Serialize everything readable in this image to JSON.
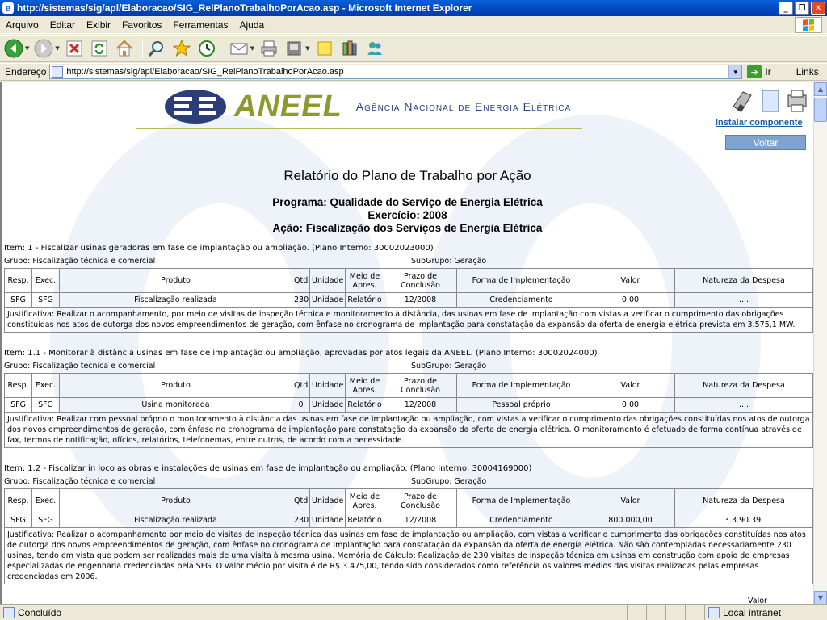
{
  "window": {
    "title": "http://sistemas/sig/apl/Elaboracao/SIG_RelPlanoTrabalhoPorAcao.asp - Microsoft Internet Explorer",
    "minimize": "_",
    "maximize": "❐",
    "close": "✕"
  },
  "menu": [
    "Arquivo",
    "Editar",
    "Exibir",
    "Favoritos",
    "Ferramentas",
    "Ajuda"
  ],
  "address": {
    "label": "Endereço",
    "url": "http://sistemas/sig/apl/Elaboracao/SIG_RelPlanoTrabalhoPorAcao.asp",
    "go": "Ir",
    "links": "Links"
  },
  "header": {
    "logo_text": "ANEEL",
    "logo_sub": "Agência Nacional de Energia Elétrica",
    "install": "Instalar componente",
    "back": "Voltar"
  },
  "report": {
    "title": "Relatório do Plano de Trabalho por Ação",
    "programa": "Programa: Qualidade do Serviço de Energia Elétrica",
    "exercicio": "Exercício: 2008",
    "acao": "Ação: Fiscalização dos Serviços de Energia Elétrica"
  },
  "columns": [
    "Resp.",
    "Exec.",
    "Produto",
    "Qtd",
    "Unidade",
    "Meio de Apres.",
    "Prazo de Conclusão",
    "Forma de Implementação",
    "Valor",
    "Natureza da Despesa"
  ],
  "items": [
    {
      "head": "Item: 1 - Fiscalizar usinas geradoras em fase de implantação ou ampliação. (Plano Interno: 30002023000)",
      "grupo": "Grupo: Fiscalização técnica e comercial",
      "subgrupo": "SubGrupo: Geração",
      "row": [
        "SFG",
        "SFG",
        "Fiscalização realizada",
        "230",
        "Unidade",
        "Relatório",
        "12/2008",
        "Credenciamento",
        "0,00",
        "...."
      ],
      "justificativa": "Justificativa: Realizar o acompanhamento, por meio de visitas de inspeção técnica e monitoramento à distância, das usinas em fase de implantação com vistas a verificar o cumprimento das obrigações constituídas nos atos de outorga dos novos empreendimentos de geração, com ênfase no cronograma de implantação para constatação da expansão da oferta de energia elétrica prevista em 3.575,1 MW."
    },
    {
      "head": "Item: 1.1 - Monitorar à distância usinas em fase de implantação ou ampliação, aprovadas por atos legais da ANEEL. (Plano Interno: 30002024000)",
      "grupo": "Grupo: Fiscalização técnica e comercial",
      "subgrupo": "SubGrupo: Geração",
      "row": [
        "SFG",
        "SFG",
        "Usina monitorada",
        "0",
        "Unidade",
        "Relatório",
        "12/2008",
        "Pessoal próprio",
        "0,00",
        "...."
      ],
      "justificativa": "Justificativa: Realizar com pessoal próprio o monitoramento à distância das usinas em fase de implantação ou ampliação, com vistas a verificar o cumprimento das obrigações constituídas nos atos de outorga dos novos empreendimentos de geração, com ênfase no cronograma de implantação para constatação da expansão da oferta de energia elétrica. O monitoramento é efetuado de forma contínua através de fax, termos de notificação, ofícios, relatórios, telefonemas, entre outros, de acordo com a necessidade."
    },
    {
      "head": "Item: 1.2 - Fiscalizar in loco as obras e instalações de usinas em fase de implantação ou ampliação. (Plano Interno: 30004169000)",
      "grupo": "Grupo: Fiscalização técnica e comercial",
      "subgrupo": "SubGrupo: Geração",
      "row": [
        "SFG",
        "SFG",
        "Fiscalização realizada",
        "230",
        "Unidade",
        "Relatório",
        "12/2008",
        "Credenciamento",
        "800.000,00",
        "3.3.90.39."
      ],
      "justificativa": "Justificativa: Realizar o acompanhamento por meio de visitas de inspeção técnica das usinas em fase de implantação ou ampliação, com vistas a verificar o cumprimento das obrigações constituídas nos atos de outorga dos novos empreendimentos de geração, com ênfase no cronograma de implantação para constatação da expansão da oferta de energia elétrica. Não são contempladas necessariamente 230 usinas, tendo em vista que podem ser realizadas mais de uma visita à mesma usina. Memória de Cálculo: Realização de 230 visitas de inspeção técnica em usinas em construção com apoio de empresas especializadas de engenharia credenciadas pela SFG. O valor médio por visita é de R$ 3.475,00, tendo sido considerados como referência os valores médios das visitas realizadas pelas empresas credenciadas em 2006."
    }
  ],
  "partial_next": "Valor",
  "status": {
    "text": "Concluído",
    "zone": "Local intranet"
  }
}
